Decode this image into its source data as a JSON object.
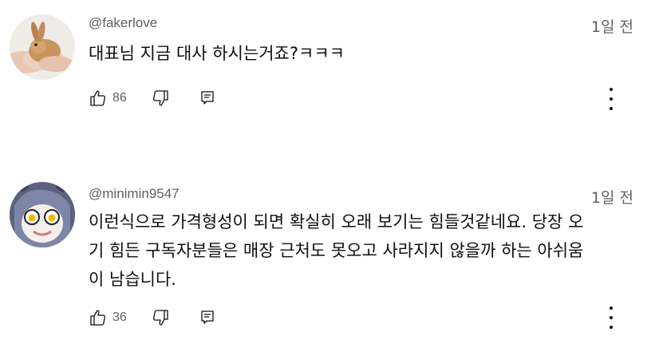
{
  "comments": [
    {
      "handle": "@fakerlove",
      "time": "1일 전",
      "text": "대표님 지금 대사 하시는거죠?ㅋㅋㅋ",
      "likes": "86",
      "avatar_icon": "rabbit-avatar"
    },
    {
      "handle": "@minimin9547",
      "time": "1일 전",
      "text_lines": [
        "이런식으로 가격형성이 되면 확실히 오래 보기는 힘들것같네요. 당장 오",
        "기 힘든 구독자분들은 매장 근처도 못오고 사라지지 않을까 하는 아쉬움",
        "이 남습니다."
      ],
      "likes": "36",
      "avatar_icon": "cartoon-face-avatar"
    }
  ],
  "icons": {
    "like": "thumbs-up-icon",
    "dislike": "thumbs-down-icon",
    "reply": "reply-icon",
    "more": "more-vertical-icon"
  }
}
